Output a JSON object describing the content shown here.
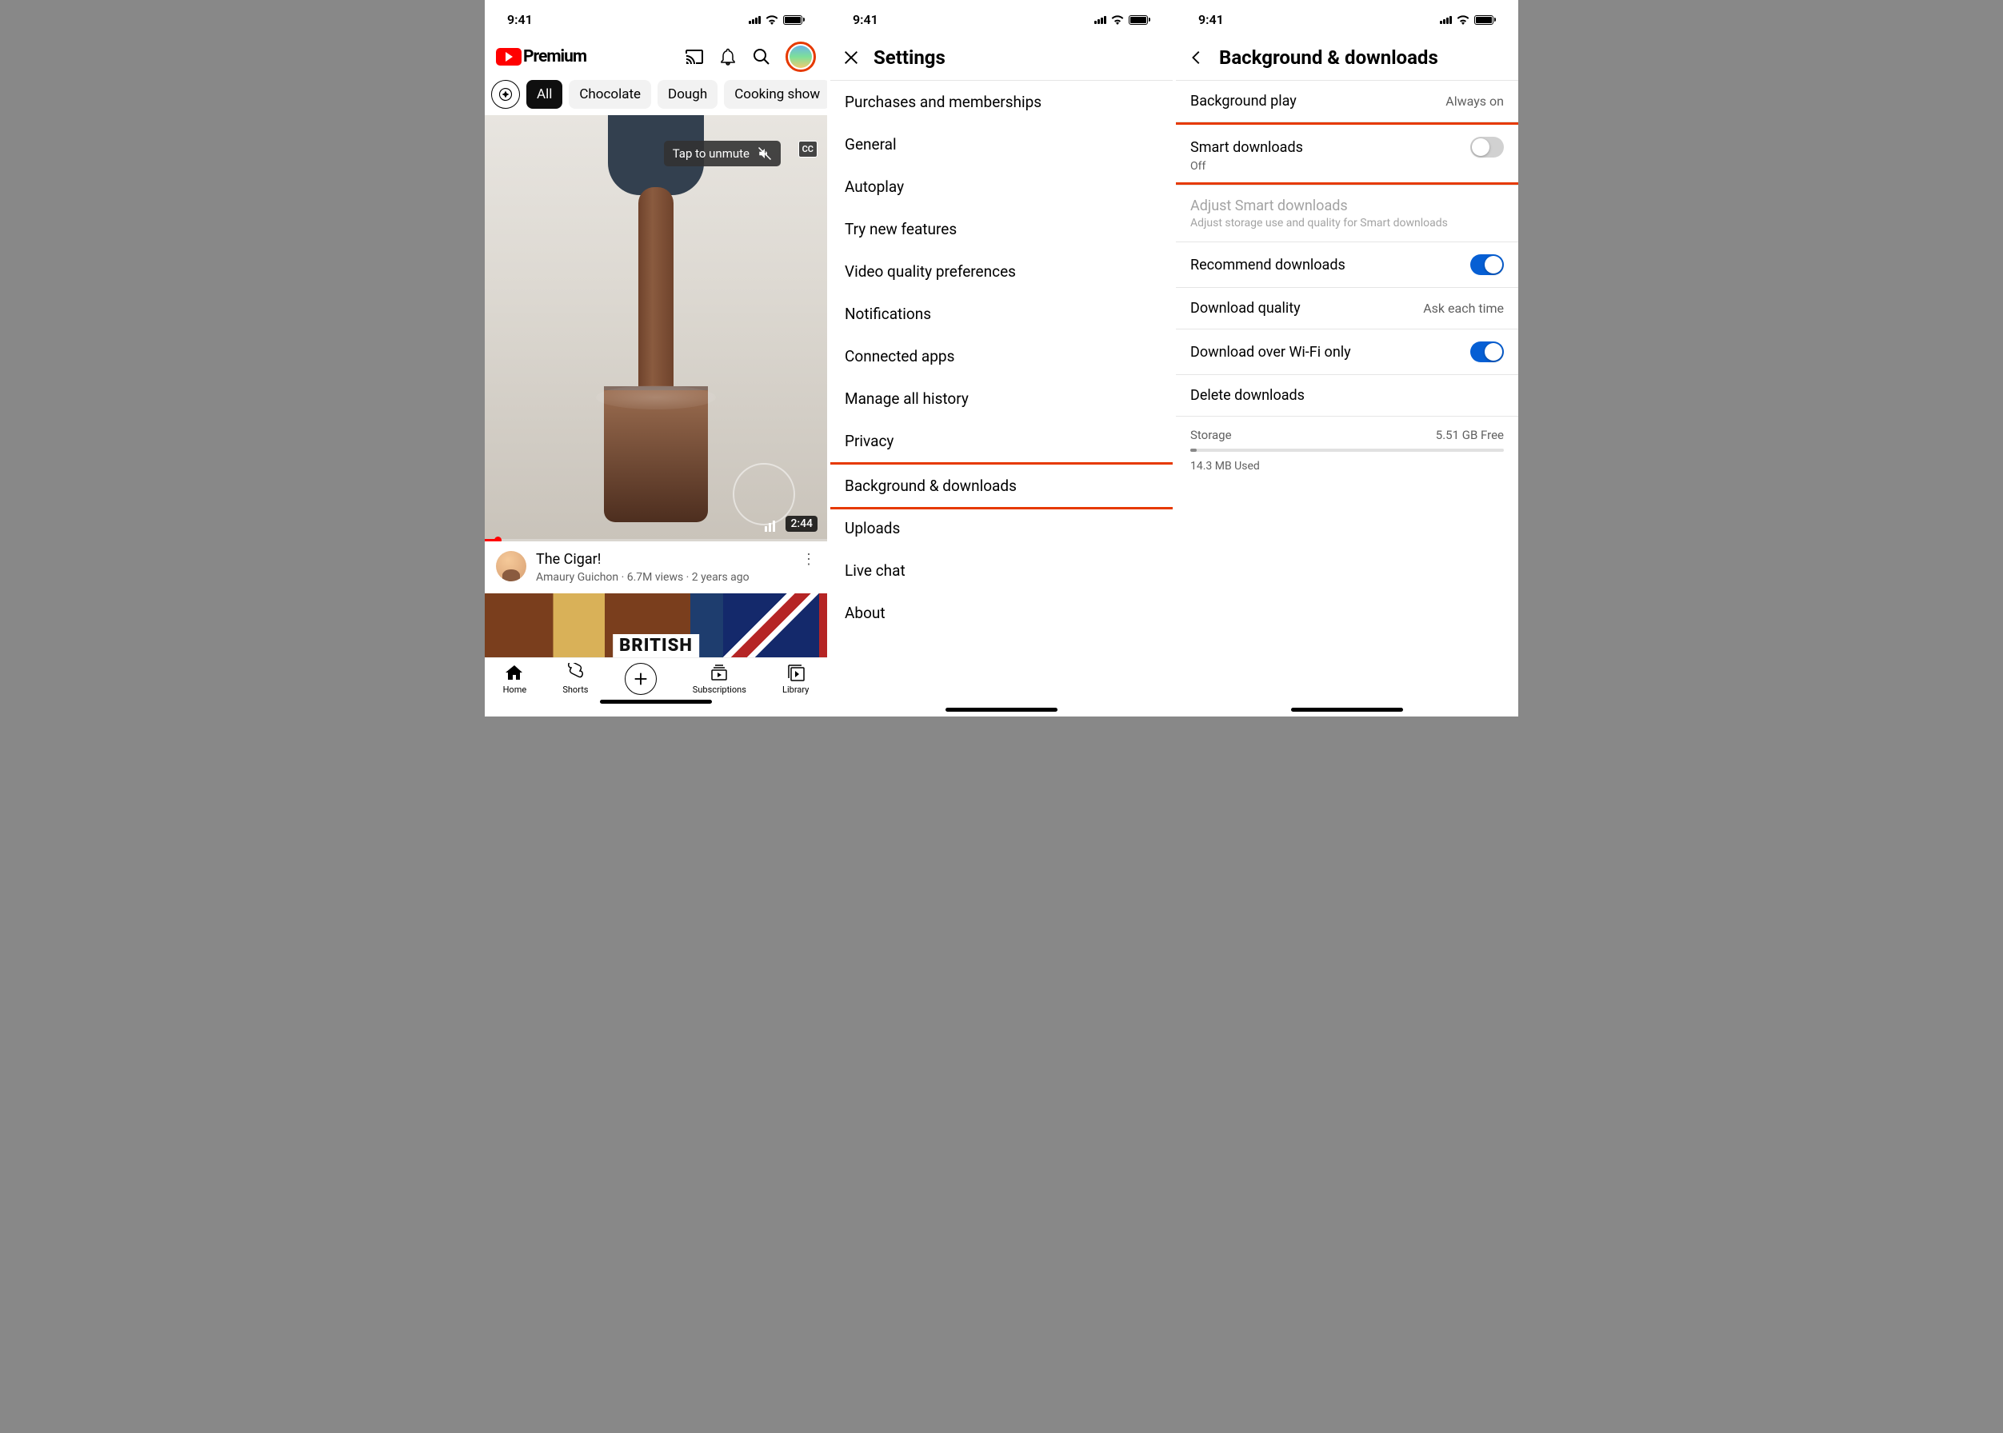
{
  "common": {
    "time": "9:41"
  },
  "screen1": {
    "brand": "Premium",
    "chips": {
      "all": "All",
      "c1": "Chocolate",
      "c2": "Dough",
      "c3": "Cooking show"
    },
    "unmute": "Tap to unmute",
    "cc": "CC",
    "duration": "2:44",
    "video": {
      "title": "The Cigar!",
      "channel_line": "Amaury Guichon · 6.7M views · 2 years ago"
    },
    "second_video_text": "BRITISH",
    "nav": {
      "home": "Home",
      "shorts": "Shorts",
      "subscriptions": "Subscriptions",
      "library": "Library"
    }
  },
  "screen2": {
    "title": "Settings",
    "items": [
      "Purchases and memberships",
      "General",
      "Autoplay",
      "Try new features",
      "Video quality preferences",
      "Notifications",
      "Connected apps",
      "Manage all history",
      "Privacy",
      "Background & downloads",
      "Uploads",
      "Live chat",
      "About"
    ]
  },
  "screen3": {
    "title": "Background & downloads",
    "background_play": {
      "label": "Background play",
      "value": "Always on"
    },
    "smart_downloads": {
      "label": "Smart downloads",
      "status": "Off"
    },
    "adjust": {
      "label": "Adjust Smart downloads",
      "sub": "Adjust storage use and quality for Smart downloads"
    },
    "recommend": {
      "label": "Recommend downloads"
    },
    "quality": {
      "label": "Download quality",
      "value": "Ask each time"
    },
    "wifi": {
      "label": "Download over Wi-Fi only"
    },
    "delete": {
      "label": "Delete downloads"
    },
    "storage": {
      "label": "Storage",
      "free": "5.51 GB Free",
      "used": "14.3 MB Used"
    }
  }
}
